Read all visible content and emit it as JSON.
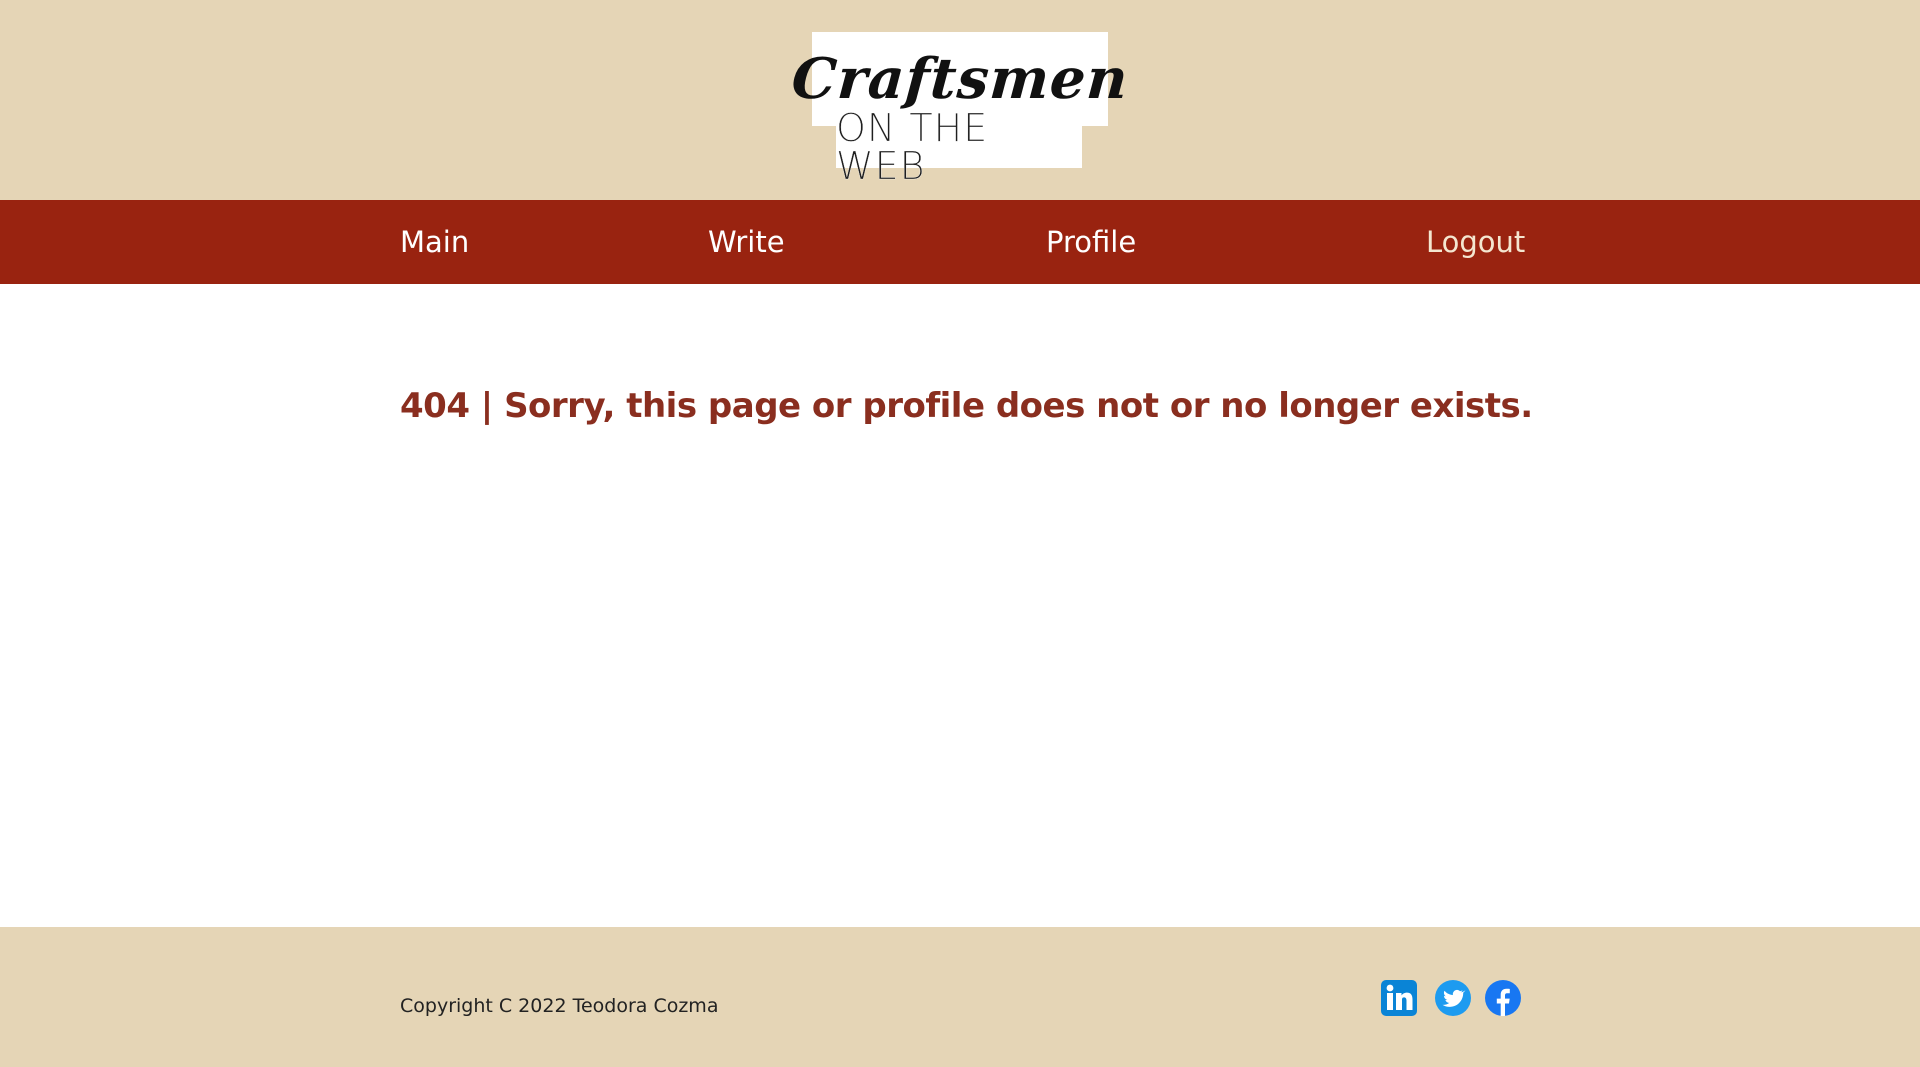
{
  "logo": {
    "title": "Craftsmen",
    "subtitle": "ON THE WEB"
  },
  "nav": {
    "items": [
      {
        "label": "Main"
      },
      {
        "label": "Write"
      },
      {
        "label": "Profile"
      },
      {
        "label": "Logout"
      }
    ]
  },
  "main": {
    "message": "404 | Sorry, this page or profile does not or no longer exists."
  },
  "footer": {
    "copyright": "Copyright C 2022 Teodora Cozma",
    "social": [
      {
        "icon": "linkedin-icon"
      },
      {
        "icon": "twitter-icon"
      },
      {
        "icon": "facebook-icon"
      }
    ]
  },
  "colors": {
    "header_bg": "#e5d5b6",
    "nav_bg": "#992310",
    "message_text": "#8a2e1f",
    "linkedin": "#0a84d6",
    "twitter": "#1d9bf0",
    "facebook": "#1877f2"
  }
}
